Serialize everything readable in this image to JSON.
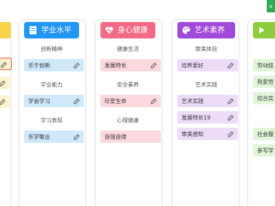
{
  "colors": {
    "blue": "#2196f3",
    "pink": "#f26b86",
    "purple": "#a04ad9",
    "green": "#8ccc3d",
    "yellow": "#f6d54a"
  },
  "columns": [
    {
      "title": "",
      "icon": "partial-icon",
      "items": [
        {
          "label": ""
        },
        {
          "label": ""
        },
        {
          "label": ""
        }
      ]
    },
    {
      "title": "学业水平",
      "icon": "book-icon",
      "sections": [
        {
          "title": "创新精神",
          "items": [
            {
              "label": "乐于创新"
            }
          ]
        },
        {
          "title": "学业能力",
          "items": [
            {
              "label": "学会学习"
            }
          ]
        },
        {
          "title": "学习表现",
          "items": [
            {
              "label": "乐学敬业"
            }
          ]
        }
      ]
    },
    {
      "title": "身心健康",
      "icon": "heart-pulse-icon",
      "sections": [
        {
          "title": "健康生活",
          "items": [
            {
              "label": "发展特长"
            }
          ]
        },
        {
          "title": "安全素养",
          "items": [
            {
              "label": "珍爱生命"
            }
          ]
        },
        {
          "title": "心理健康",
          "items": [
            {
              "label": "自强自律"
            }
          ]
        }
      ]
    },
    {
      "title": "艺术素养",
      "icon": "palette-icon",
      "sections": [
        {
          "title": "审美体验",
          "items": [
            {
              "label": "培养爱好"
            }
          ]
        },
        {
          "title": "艺术实践",
          "items": [
            {
              "label": "艺术实践"
            },
            {
              "label": "发展特长19"
            },
            {
              "label": "审美感知"
            }
          ]
        }
      ]
    },
    {
      "title": "",
      "icon": "flag-icon",
      "items": [
        {
          "label": "劳动技"
        },
        {
          "label": "热爱劳"
        },
        {
          "label": "综合实"
        },
        {
          "label": "社会服"
        },
        {
          "label": "参写学"
        }
      ]
    }
  ]
}
